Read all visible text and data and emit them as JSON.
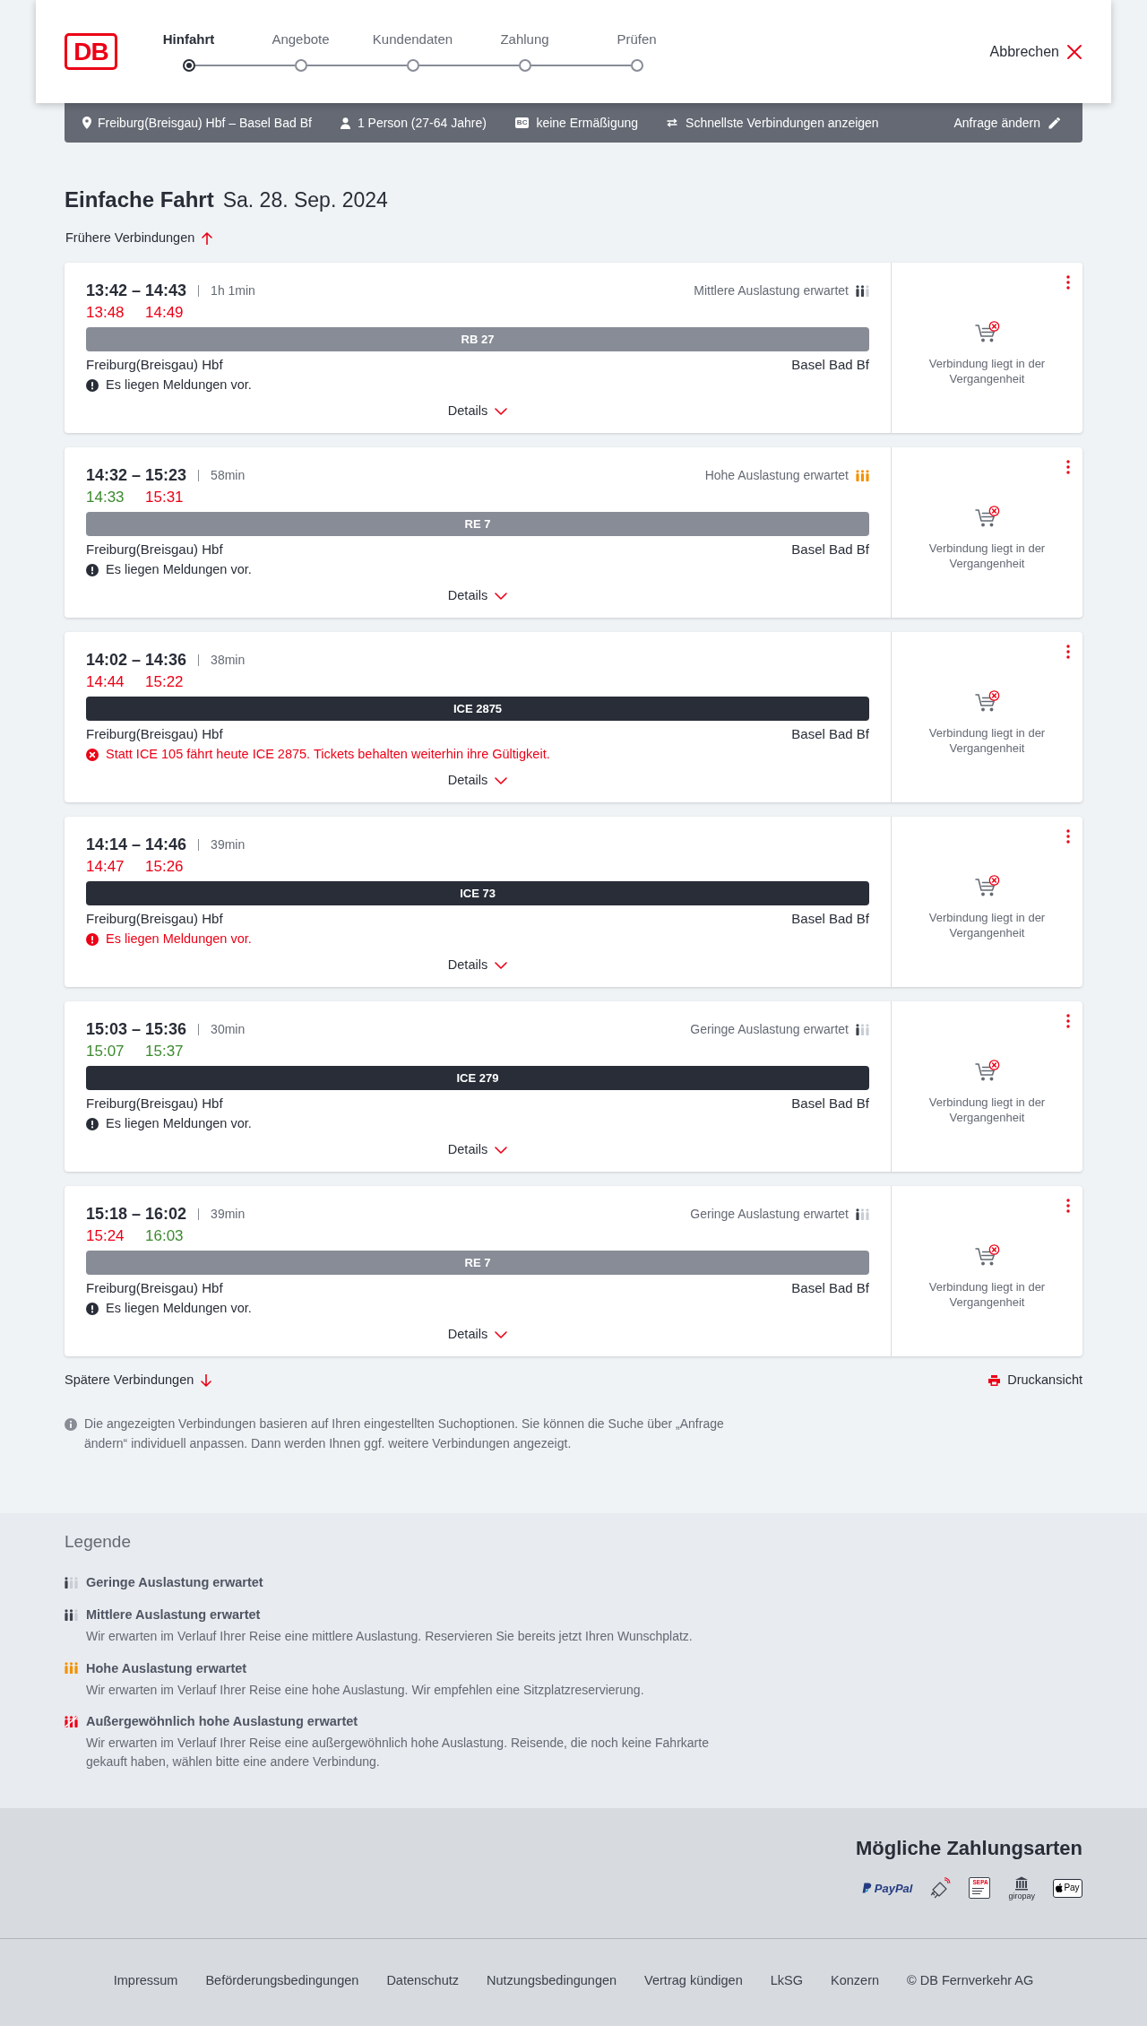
{
  "header": {
    "logo": "DB",
    "steps": [
      {
        "label": "Hinfahrt",
        "selected": true
      },
      {
        "label": "Angebote",
        "selected": false
      },
      {
        "label": "Kundendaten",
        "selected": false
      },
      {
        "label": "Zahlung",
        "selected": false
      },
      {
        "label": "Prüfen",
        "selected": false
      }
    ],
    "cancel": "Abbrechen"
  },
  "search_summary": {
    "route": "Freiburg(Breisgau) Hbf – Basel Bad Bf",
    "travellers": "1 Person (27-64 Jahre)",
    "discount_badge": "BC",
    "discount": "keine Ermäßigung",
    "option": "Schnellste Verbindungen anzeigen",
    "edit": "Anfrage ändern"
  },
  "heading": {
    "title": "Einfache Fahrt",
    "date": "Sa. 28. Sep. 2024"
  },
  "earlier_link": "Frühere Verbindungen",
  "connections": [
    {
      "times": "13:42 – 14:43",
      "duration": "1h 1min",
      "occupancy": {
        "kind": "medium",
        "text": "Mittlere Auslastung erwartet"
      },
      "realtime": [
        {
          "time": "13:48",
          "delayed": true
        },
        {
          "time": "14:49",
          "delayed": true
        }
      ],
      "train": {
        "name": "RB 27",
        "kind": "regional"
      },
      "from": "Freiburg(Breisgau) Hbf",
      "to": "Basel Bad Bf",
      "message": {
        "kind": "notice",
        "text": "Es liegen Meldungen vor."
      },
      "details": "Details",
      "status": "Verbindung liegt in der Vergangenheit"
    },
    {
      "times": "14:32 – 15:23",
      "duration": "58min",
      "occupancy": {
        "kind": "high",
        "text": "Hohe Auslastung erwartet"
      },
      "realtime": [
        {
          "time": "14:33",
          "delayed": false
        },
        {
          "time": "15:31",
          "delayed": true
        }
      ],
      "train": {
        "name": "RE 7",
        "kind": "regional"
      },
      "from": "Freiburg(Breisgau) Hbf",
      "to": "Basel Bad Bf",
      "message": {
        "kind": "notice",
        "text": "Es liegen Meldungen vor."
      },
      "details": "Details",
      "status": "Verbindung liegt in der Vergangenheit"
    },
    {
      "times": "14:02 – 14:36",
      "duration": "38min",
      "realtime": [
        {
          "time": "14:44",
          "delayed": true
        },
        {
          "time": "15:22",
          "delayed": true
        }
      ],
      "train": {
        "name": "ICE 2875",
        "kind": "long_distance"
      },
      "from": "Freiburg(Breisgau) Hbf",
      "to": "Basel Bad Bf",
      "message": {
        "kind": "change",
        "text": "Statt ICE 105 fährt heute ICE 2875. Tickets behalten weiterhin ihre Gültigkeit."
      },
      "details": "Details",
      "status": "Verbindung liegt in der Vergangenheit"
    },
    {
      "times": "14:14 – 14:46",
      "duration": "39min",
      "realtime": [
        {
          "time": "14:47",
          "delayed": true
        },
        {
          "time": "15:26",
          "delayed": true
        }
      ],
      "train": {
        "name": "ICE 73",
        "kind": "long_distance"
      },
      "from": "Freiburg(Breisgau) Hbf",
      "to": "Basel Bad Bf",
      "message": {
        "kind": "important",
        "text": "Es liegen Meldungen vor."
      },
      "details": "Details",
      "status": "Verbindung liegt in der Vergangenheit"
    },
    {
      "times": "15:03 – 15:36",
      "duration": "30min",
      "occupancy": {
        "kind": "low",
        "text": "Geringe Auslastung erwartet"
      },
      "realtime": [
        {
          "time": "15:07",
          "delayed": false
        },
        {
          "time": "15:37",
          "delayed": false
        }
      ],
      "train": {
        "name": "ICE 279",
        "kind": "long_distance"
      },
      "from": "Freiburg(Breisgau) Hbf",
      "to": "Basel Bad Bf",
      "message": {
        "kind": "notice",
        "text": "Es liegen Meldungen vor."
      },
      "details": "Details",
      "status": "Verbindung liegt in der Vergangenheit"
    },
    {
      "times": "15:18 – 16:02",
      "duration": "39min",
      "occupancy": {
        "kind": "low",
        "text": "Geringe Auslastung erwartet"
      },
      "realtime": [
        {
          "time": "15:24",
          "delayed": true
        },
        {
          "time": "16:03",
          "delayed": false
        }
      ],
      "train": {
        "name": "RE 7",
        "kind": "regional"
      },
      "from": "Freiburg(Breisgau) Hbf",
      "to": "Basel Bad Bf",
      "message": {
        "kind": "notice",
        "text": "Es liegen Meldungen vor."
      },
      "details": "Details",
      "status": "Verbindung liegt in der Vergangenheit"
    }
  ],
  "later_link": "Spätere Verbindungen",
  "print_link": "Druckansicht",
  "info_note": "Die angezeigten Verbindungen basieren auf Ihren eingestellten Suchoptionen. Sie können die Suche über „Anfrage ändern“ individuell anpassen. Dann werden Ihnen ggf. weitere Verbindungen angezeigt.",
  "legend": {
    "title": "Legende",
    "items": [
      {
        "kind": "low",
        "title": "Geringe Auslastung erwartet"
      },
      {
        "kind": "medium",
        "title": "Mittlere Auslastung erwartet",
        "description": "Wir erwarten im Verlauf Ihrer Reise eine mittlere Auslastung. Reservieren Sie bereits jetzt Ihren Wunschplatz."
      },
      {
        "kind": "high",
        "title": "Hohe Auslastung erwartet",
        "description": "Wir erwarten im Verlauf Ihrer Reise eine hohe Auslastung. Wir empfehlen eine Sitzplatzreservierung."
      },
      {
        "kind": "exceptional",
        "title": "Außergewöhnlich hohe Auslastung erwartet",
        "description": "Wir erwarten im Verlauf Ihrer Reise eine außergewöhnlich hohe Auslastung. Reisende, die noch keine Fahrkarte gekauft haben, wählen bitte eine andere Verbindung."
      }
    ]
  },
  "payment": {
    "title": "Mögliche Zahlungsarten",
    "methods": [
      {
        "kind": "paypal",
        "label": "PayPal"
      },
      {
        "kind": "contactless_card"
      },
      {
        "kind": "sepa",
        "label": "SEPA"
      },
      {
        "kind": "giropay",
        "label": "giropay"
      },
      {
        "kind": "apple_pay",
        "label": "Pay"
      }
    ]
  },
  "footer": {
    "links": [
      "Impressum",
      "Beförderungsbedingungen",
      "Datenschutz",
      "Nutzungsbedingungen",
      "Vertrag kündigen",
      "LkSG",
      "Konzern"
    ],
    "copyright": "© DB Fernverkehr AG"
  }
}
